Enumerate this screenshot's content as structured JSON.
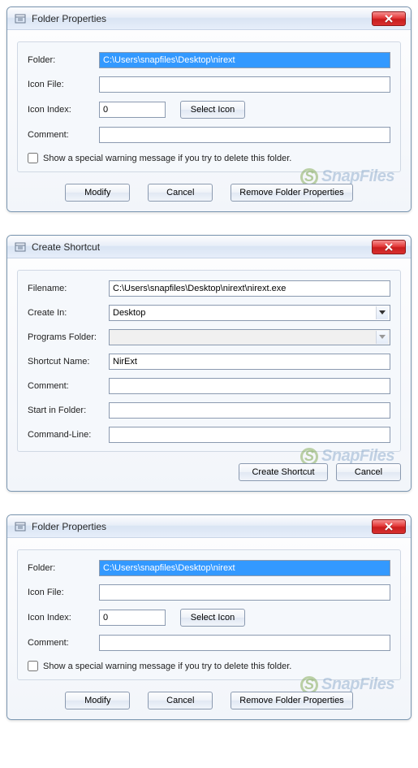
{
  "watermark": "SnapFiles",
  "dialog1": {
    "title": "Folder Properties",
    "folder_label": "Folder:",
    "folder_value": "C:\\Users\\snapfiles\\Desktop\\nirext",
    "iconfile_label": "Icon File:",
    "iconfile_value": "",
    "iconindex_label": "Icon Index:",
    "iconindex_value": "0",
    "selecticon_btn": "Select Icon",
    "comment_label": "Comment:",
    "comment_value": "",
    "checkbox_label": "Show a special warning message if you try to delete this folder.",
    "modify_btn": "Modify",
    "cancel_btn": "Cancel",
    "remove_btn": "Remove Folder Properties"
  },
  "dialog2": {
    "title": "Create Shortcut",
    "filename_label": "Filename:",
    "filename_value": "C:\\Users\\snapfiles\\Desktop\\nirext\\nirext.exe",
    "createin_label": "Create In:",
    "createin_value": "Desktop",
    "progfolder_label": "Programs Folder:",
    "progfolder_value": "",
    "shortcutname_label": "Shortcut Name:",
    "shortcutname_value": "NirExt",
    "comment_label": "Comment:",
    "comment_value": "",
    "startin_label": "Start in Folder:",
    "startin_value": "",
    "cmdline_label": "Command-Line:",
    "cmdline_value": "",
    "create_btn": "Create Shortcut",
    "cancel_btn": "Cancel"
  },
  "dialog3": {
    "title": "Folder Properties",
    "folder_label": "Folder:",
    "folder_value": "C:\\Users\\snapfiles\\Desktop\\nirext",
    "iconfile_label": "Icon File:",
    "iconfile_value": "",
    "iconindex_label": "Icon Index:",
    "iconindex_value": "0",
    "selecticon_btn": "Select Icon",
    "comment_label": "Comment:",
    "comment_value": "",
    "checkbox_label": "Show a special warning message if you try to delete this folder.",
    "modify_btn": "Modify",
    "cancel_btn": "Cancel",
    "remove_btn": "Remove Folder Properties"
  }
}
